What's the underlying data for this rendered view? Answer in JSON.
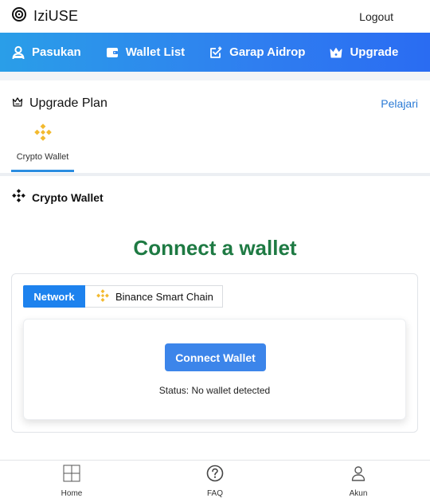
{
  "header": {
    "brand": "IziUSE",
    "brand_icon": "target-logo-icon",
    "logout_label": "Logout"
  },
  "nav": {
    "items": [
      {
        "label": "Pasukan",
        "icon": "user-group-icon"
      },
      {
        "label": "Wallet List",
        "icon": "wallet-icon"
      },
      {
        "label": "Garap Aidrop",
        "icon": "task-check-icon"
      },
      {
        "label": "Upgrade",
        "icon": "crown-icon"
      }
    ],
    "gradient": [
      "#2a9ee8",
      "#2a6cf2"
    ]
  },
  "plan": {
    "title": "Upgrade Plan",
    "icon": "crown-outline-icon",
    "link_label": "Pelajari",
    "tabs": [
      {
        "label": "Crypto Wallet",
        "icon": "binance-icon",
        "active": true
      }
    ]
  },
  "section": {
    "title": "Crypto Wallet",
    "icon": "binance-black-icon",
    "heading": "Connect a wallet",
    "heading_color": "#1e7a43"
  },
  "network": {
    "label": "Network",
    "selected": "Binance Smart Chain",
    "selected_icon": "binance-icon"
  },
  "wallet": {
    "button_label": "Connect Wallet",
    "status": "Status: No wallet detected"
  },
  "bottom_nav": {
    "items": [
      {
        "label": "Home",
        "icon": "grid-icon"
      },
      {
        "label": "FAQ",
        "icon": "question-circle-icon"
      },
      {
        "label": "Akun",
        "icon": "user-icon"
      }
    ]
  },
  "colors": {
    "accent": "#2b8de0",
    "binance_yellow": "#f3ba2f",
    "link": "#2a7ad5"
  }
}
